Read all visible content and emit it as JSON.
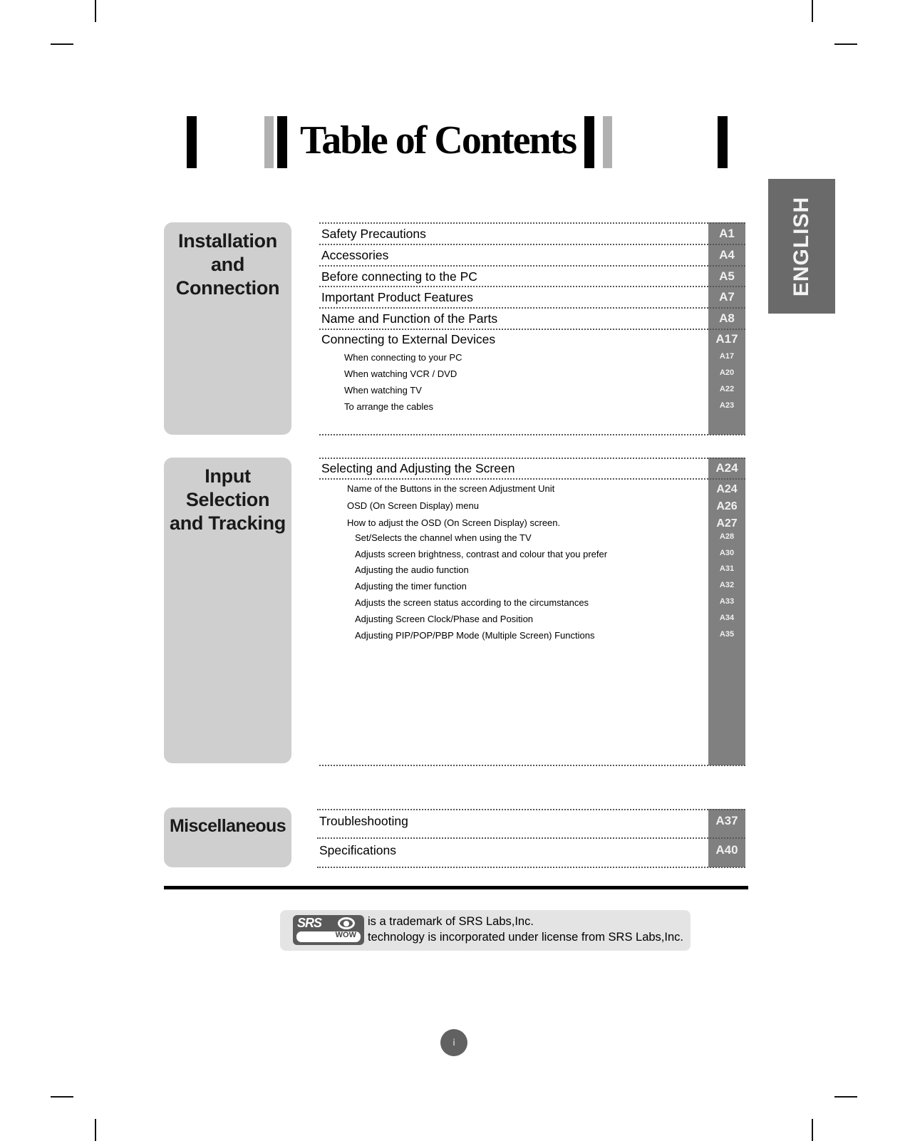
{
  "title": "Table of Contents",
  "language_tab": "ENGLISH",
  "sections": [
    {
      "label_lines": [
        "Installation",
        "and",
        "Connection"
      ],
      "entries": [
        {
          "text": "Safety Precautions",
          "page": "A1",
          "level": "main"
        },
        {
          "text": "Accessories",
          "page": "A4",
          "level": "main"
        },
        {
          "text": "Before connecting to the PC",
          "page": "A5",
          "level": "main"
        },
        {
          "text": "Important Product Features",
          "page": "A7",
          "level": "main"
        },
        {
          "text": "Name and Function of the Parts",
          "page": "A8",
          "level": "main"
        },
        {
          "text": "Connecting to External Devices",
          "page": "A17",
          "level": "main"
        },
        {
          "text": "When connecting to your PC",
          "page": "A17",
          "level": "sub"
        },
        {
          "text": "When watching VCR / DVD",
          "page": "A20",
          "level": "sub"
        },
        {
          "text": "When watching TV",
          "page": "A22",
          "level": "sub"
        },
        {
          "text": "To arrange the cables",
          "page": "A23",
          "level": "sub"
        }
      ]
    },
    {
      "label_lines": [
        "Input",
        "Selection",
        "and Tracking"
      ],
      "entries": [
        {
          "text": "Selecting and Adjusting the Screen",
          "page": "A24",
          "level": "main"
        },
        {
          "text": "Name of the Buttons in the screen Adjustment Unit",
          "page": "A24",
          "level": "sub"
        },
        {
          "text": "OSD (On Screen Display) menu",
          "page": "A26",
          "level": "sub"
        },
        {
          "text": "How to adjust the OSD (On Screen Display) screen.",
          "page": "A27",
          "level": "sub"
        },
        {
          "text": "Set/Selects the channel when using the TV",
          "page": "A28",
          "level": "subsub"
        },
        {
          "text": "Adjusts screen brightness, contrast and colour  that you prefer",
          "page": "A30",
          "level": "subsub"
        },
        {
          "text": "Adjusting the audio function",
          "page": "A31",
          "level": "subsub"
        },
        {
          "text": "Adjusting the timer function",
          "page": "A32",
          "level": "subsub"
        },
        {
          "text": "Adjusts the screen status according to the circumstances",
          "page": "A33",
          "level": "subsub"
        },
        {
          "text": "Adjusting Screen Clock/Phase and Position",
          "page": "A34",
          "level": "subsub"
        },
        {
          "text": "Adjusting PIP/POP/PBP Mode (Multiple Screen) Functions",
          "page": "A35",
          "level": "subsub"
        }
      ]
    },
    {
      "label_lines": [
        "Miscellaneous"
      ],
      "entries": [
        {
          "text": "Troubleshooting",
          "page": "A37",
          "level": "main"
        },
        {
          "text": "Specifications",
          "page": "A40",
          "level": "main"
        }
      ]
    }
  ],
  "trademark": {
    "logo_top": "SRS",
    "logo_bottom": "WOW",
    "line1": "is a trademark of SRS Labs,Inc.",
    "line2": "technology is incorporated under license from SRS Labs,Inc."
  },
  "page_number": "i",
  "colors": {
    "section_box": "#cfcfcf",
    "page_column": "#808080",
    "language_tab": "#6a6a6a",
    "accent_gray_bar": "#b0b0b0"
  }
}
